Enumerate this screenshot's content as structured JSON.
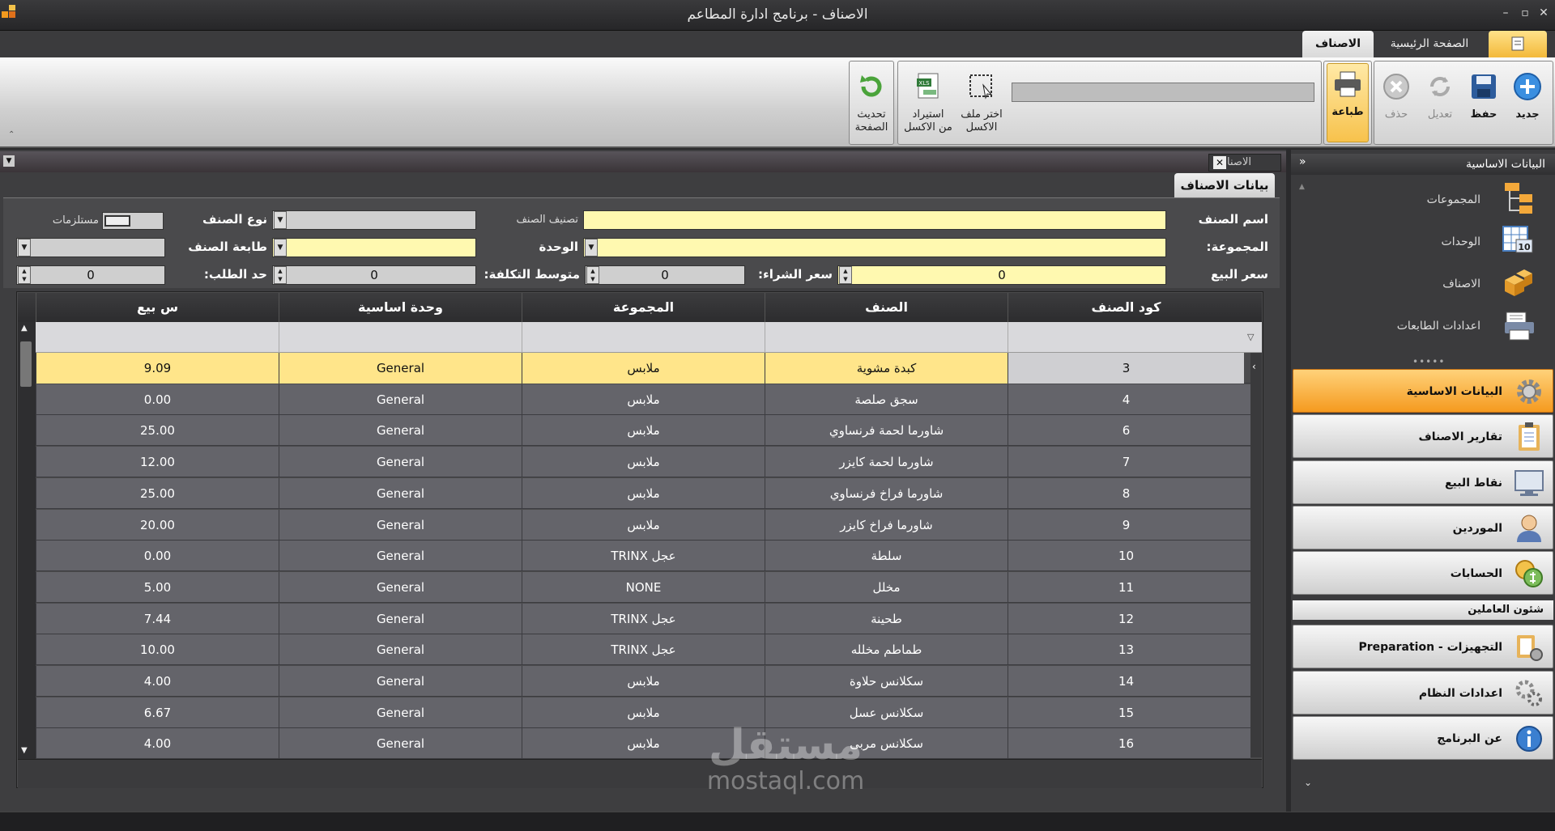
{
  "window": {
    "title": "الاصناف - برنامج ادارة المطاعم"
  },
  "ribbon_tabs": [
    "الاصناف",
    "الصفحة الرئيسية"
  ],
  "toolbar": {
    "new": "جديد",
    "save": "حفظ",
    "edit": "تعديل",
    "delete": "حذف",
    "print": "طباعة",
    "choose_excel_1": "اختر ملف",
    "choose_excel_2": "الاكسل",
    "import_excel_1": "استيراد",
    "import_excel_2": "من الاكسل",
    "refresh_1": "تحديث",
    "refresh_2": "الصفحة",
    "xls_badge": "XLS"
  },
  "doc_tab": "الاصناف",
  "sub_tab": "بيانات الاصناف",
  "form": {
    "item_name": "اسم الصنف",
    "classification": "تصنيف الصنف",
    "item_type": "نوع الصنف",
    "supplies": "مستلزمات",
    "group": "المجموعة:",
    "unit": "الوحدة",
    "printer": "طابعة الصنف",
    "sale_price": "سعر البيع",
    "sale_price_value": "0",
    "purchase_price": "سعر الشراء:",
    "purchase_price_value": "0",
    "avg_cost": "متوسط التكلفة:",
    "avg_cost_value": "0",
    "reorder": "حد الطلب:",
    "reorder_value": "0"
  },
  "grid": {
    "columns": [
      "كود الصنف",
      "الصنف",
      "المجموعة",
      "وحدة اساسية",
      "س بيع"
    ],
    "rows": [
      [
        "3",
        "كبدة مشوية",
        "ملابس",
        "General",
        "9.09"
      ],
      [
        "4",
        "سجق صلصة",
        "ملابس",
        "General",
        "0.00"
      ],
      [
        "6",
        "شاورما لحمة فرنساوي",
        "ملابس",
        "General",
        "25.00"
      ],
      [
        "7",
        "شاورما لحمة كايزر",
        "ملابس",
        "General",
        "12.00"
      ],
      [
        "8",
        "شاورما فراخ فرنساوي",
        "ملابس",
        "General",
        "25.00"
      ],
      [
        "9",
        "شاورما فراخ كايزر",
        "ملابس",
        "General",
        "20.00"
      ],
      [
        "10",
        "سلطة",
        "عجل TRINX",
        "General",
        "0.00"
      ],
      [
        "11",
        "مخلل",
        "NONE",
        "General",
        "5.00"
      ],
      [
        "12",
        "طحينة",
        "عجل TRINX",
        "General",
        "7.44"
      ],
      [
        "13",
        "طماطم مخلله",
        "عجل TRINX",
        "General",
        "10.00"
      ],
      [
        "14",
        "سكلانس حلاوة",
        "ملابس",
        "General",
        "4.00"
      ],
      [
        "15",
        "سكلانس عسل",
        "ملابس",
        "General",
        "6.67"
      ],
      [
        "16",
        "سكلانس مربى",
        "ملابس",
        "General",
        "4.00"
      ]
    ],
    "selected_row": 0
  },
  "nav": {
    "title": "البيانات الاساسية",
    "subitems": [
      "المجموعات",
      "الوحدات",
      "الاصناف",
      "اعدادات الطابعات"
    ],
    "units_badge": "10",
    "buttons": [
      "البيانات الاساسية",
      "تقارير الاصناف",
      "نقاط البيع",
      "الموردين",
      "الحسابات"
    ],
    "section_header": "شئون العاملين",
    "buttons2": [
      "التجهيزات - Preparation",
      "اعدادات النظام",
      "عن البرنامج"
    ]
  },
  "watermark": {
    "ar": "مستقل",
    "en": "mostaql.com"
  },
  "colors": {
    "accent": "#f59a1f",
    "selected_row": "#ffe58a",
    "field_yellow": "#fff9b0"
  }
}
